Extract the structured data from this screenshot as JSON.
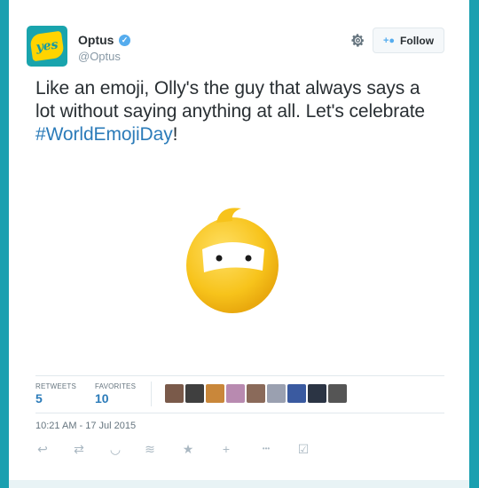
{
  "user": {
    "name": "Optus",
    "handle": "@Optus",
    "avatar_text": "yes",
    "verified_glyph": "✓"
  },
  "follow": {
    "label": "Follow"
  },
  "tweet": {
    "text_before": "Like an emoji, Olly's the guy that always says a lot without saying anything at all. Let's celebrate ",
    "hashtag": "#WorldEmojiDay",
    "text_after": "!"
  },
  "stats": {
    "retweets_label": "RETWEETS",
    "retweets_value": "5",
    "favorites_label": "FAVORITES",
    "favorites_value": "10"
  },
  "favoriters": [
    {
      "color": "#7a5a4a"
    },
    {
      "color": "#3f3f3f"
    },
    {
      "color": "#c9873a"
    },
    {
      "color": "#b88ab0"
    },
    {
      "color": "#8a6a5a"
    },
    {
      "color": "#9aa0b0"
    },
    {
      "color": "#3a5aa0"
    },
    {
      "color": "#2b3444"
    },
    {
      "color": "#555555"
    }
  ],
  "timestamp": "10:21 AM - 17 Jul 2015",
  "actions": [
    {
      "name": "reply-icon",
      "glyph": "↩"
    },
    {
      "name": "retweet-icon",
      "glyph": "⇄"
    },
    {
      "name": "pocket-icon",
      "glyph": "◡"
    },
    {
      "name": "buffer-icon",
      "glyph": "≋"
    },
    {
      "name": "favorite-icon",
      "glyph": "★"
    },
    {
      "name": "follow-user-icon",
      "glyph": "+"
    },
    {
      "name": "more-icon",
      "glyph": "•••"
    },
    {
      "name": "checkbox-icon",
      "glyph": "☑"
    }
  ],
  "colors": {
    "background": "#1ba0b0",
    "link": "#2b7bb9",
    "emoji_yellow": "#f7c31b"
  }
}
